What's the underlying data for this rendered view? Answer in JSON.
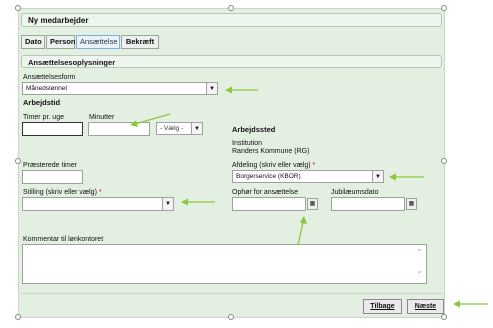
{
  "panel": {
    "title": "Ny medarbejder"
  },
  "tabs": [
    {
      "label": "Dato"
    },
    {
      "label": "Person"
    },
    {
      "label": "Ansættelse"
    },
    {
      "label": "Bekræft"
    }
  ],
  "section": {
    "title": "Ansættelsesoplysninger"
  },
  "ansaettelsesform": {
    "label": "Ansættelsesform",
    "value": "Månedslønnet"
  },
  "arbejdstid": {
    "heading": "Arbejdstid",
    "timer_label": "Timer pr. uge",
    "timer_value": "",
    "minutter_label": "Minutter",
    "minutter_value": "",
    "vaelg_value": "- Vælg -"
  },
  "arbejdssted": {
    "heading": "Arbejdssted",
    "institution_label": "Institution",
    "institution_value": "Randers Kommune (RG)"
  },
  "praesterede": {
    "label": "Præsterede timer",
    "value": ""
  },
  "afdeling": {
    "label": "Afdeling (skriv eller vælg)",
    "required": "*",
    "value": "Borgerservice (KBOR)"
  },
  "stilling": {
    "label": "Stilling (skriv eller vælg)",
    "required": "*",
    "value": ""
  },
  "ophoer": {
    "label": "Ophør for ansættelse",
    "value": ""
  },
  "jubilaeum": {
    "label": "Jubilæumsdato",
    "value": ""
  },
  "kommentar": {
    "label": "Kommentar til lønkontoret",
    "value": ""
  },
  "buttons": {
    "back": "Tilbage",
    "next": "Næste"
  },
  "icons": {
    "dropdown": "chevron-down-icon",
    "calendar": "calendar-icon",
    "scroll_up": "chevron-up-icon",
    "scroll_down": "chevron-down-icon"
  },
  "colors": {
    "panel_bg": "#e3efe1",
    "annotation_arrow": "#8cc63f",
    "active_tab": "#e8f3ff"
  }
}
